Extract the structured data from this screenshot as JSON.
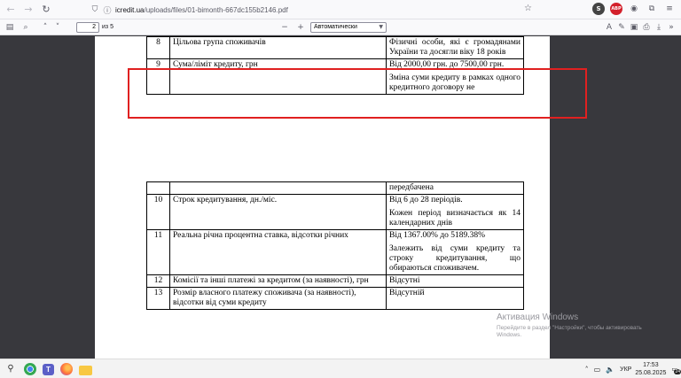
{
  "browser": {
    "url_host": "icredit.ua",
    "url_path": "/uploads/files/01-bimonth-667dc155b2146.pdf"
  },
  "pdf_toolbar": {
    "current_page": "2",
    "page_count_text": "из 5",
    "zoom_value": "Автоматически"
  },
  "document": {
    "page1_rows": [
      {
        "num": "8",
        "name": "Цільова група споживачів",
        "values": [
          "Фізичні особи, які є громадянами України та досягли віку 18 років"
        ]
      },
      {
        "num": "9",
        "name": "Сума/ліміт кредиту, грн",
        "values": [
          "Від 2000,00 грн. до 7500,00 грн.",
          "Зміна суми кредиту в рамках одного кредитного договору не"
        ]
      }
    ],
    "page2_rows": [
      {
        "num": "",
        "name": "",
        "values": [
          "передбачена"
        ]
      },
      {
        "num": "10",
        "name": "Строк кредитування, дн./міс.",
        "values": [
          "Від 6 до 28 періодів.",
          "Кожен період визначається як 14 календарних днів"
        ]
      },
      {
        "num": "11",
        "name": "Реальна річна процентна ставка, відсотки річних",
        "values": [
          "Від 1367.00% до 5189.38%",
          "Залежить від суми кредиту та строку кредитування, що обираються споживачем."
        ]
      },
      {
        "num": "12",
        "name": "Комісії та інші платежі за кредитом (за наявності), грн",
        "values": [
          "Відсутні"
        ]
      },
      {
        "num": "13",
        "name": "Розмір власного платежу споживача (за наявності), відсотки від суми кредиту",
        "values": [
          "Відсутній"
        ]
      }
    ]
  },
  "watermark": {
    "title": "Активация Windows",
    "subtitle": "Перейдите в раздел \"Настройки\", чтобы активировать Windows."
  },
  "taskbar": {
    "language": "УКР",
    "time": "17:53",
    "date": "25.08.2025",
    "notification_count": "24"
  },
  "colors": {
    "highlight_border": "#e02020",
    "viewer_bg": "#38383d"
  }
}
